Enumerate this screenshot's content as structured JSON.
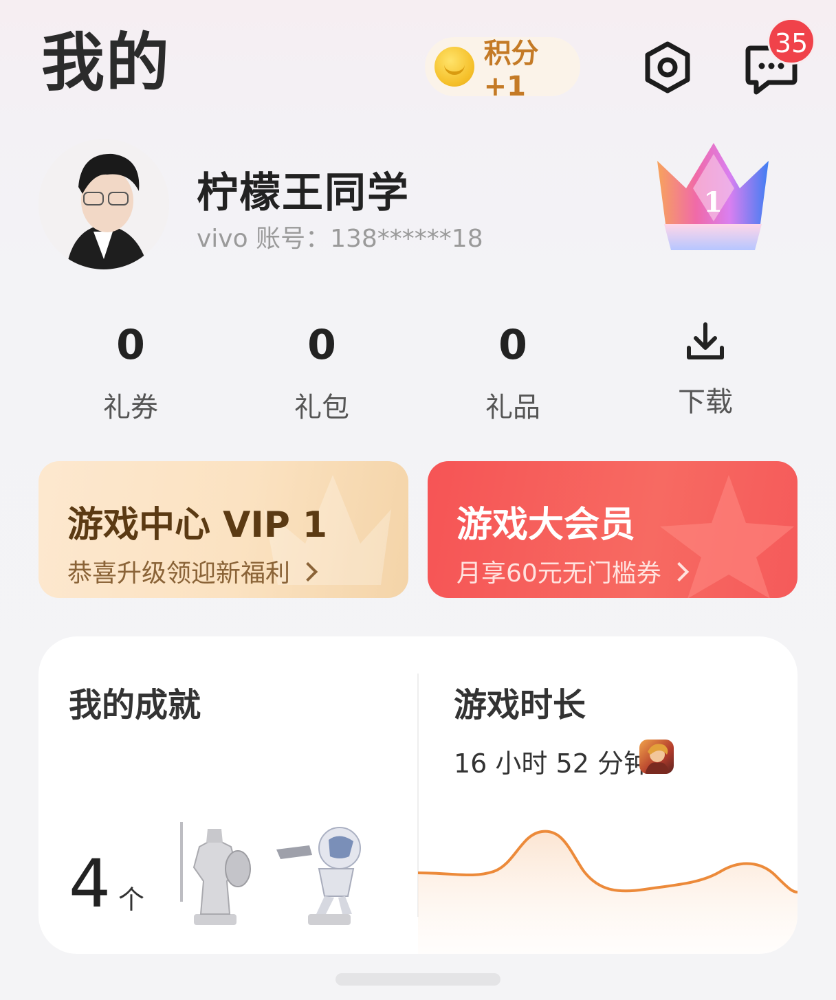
{
  "header": {
    "title": "我的",
    "points_label": "积分+1",
    "message_badge": "35",
    "icons": [
      "coin-icon",
      "settings-icon",
      "message-icon"
    ]
  },
  "profile": {
    "name": "柠檬王同学",
    "account": "vivo 账号：138******18",
    "level_badge_text": "1"
  },
  "stats": [
    {
      "value": "0",
      "label": "礼券"
    },
    {
      "value": "0",
      "label": "礼包"
    },
    {
      "value": "0",
      "label": "礼品"
    },
    {
      "label": "下载",
      "icon": "download-icon"
    }
  ],
  "vip_card": {
    "title": "游戏中心 VIP 1",
    "subtitle": "恭喜升级领迎新福利"
  },
  "member_card": {
    "title": "游戏大会员",
    "subtitle": "月享60元无门槛券"
  },
  "achievements": {
    "title": "我的成就",
    "count": "4",
    "unit": "个"
  },
  "playtime": {
    "title": "游戏时长",
    "duration": "16 小时 52 分钟"
  },
  "colors": {
    "accent_curve": "#ec8a3a",
    "badge_red": "#f0424a",
    "member_red": "#f65455",
    "vip_gold": "#fbe2c1"
  }
}
